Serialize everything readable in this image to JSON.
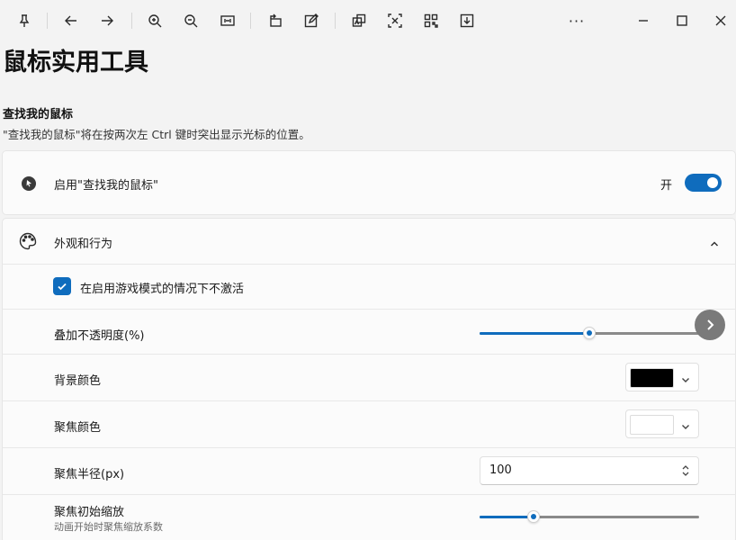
{
  "toolbar": {
    "buttons": [
      {
        "name": "pin-icon"
      },
      {
        "name": "back-arrow-icon"
      },
      {
        "name": "forward-arrow-icon"
      },
      {
        "name": "zoom-in-icon"
      },
      {
        "name": "zoom-out-icon"
      },
      {
        "name": "fit-width-icon"
      },
      {
        "name": "rotate-icon"
      },
      {
        "name": "edit-icon"
      },
      {
        "name": "translate-icon"
      },
      {
        "name": "crop-icon"
      },
      {
        "name": "qr-code-icon"
      },
      {
        "name": "download-icon"
      }
    ],
    "more_label": "···",
    "window_controls": [
      "minimize-icon",
      "maximize-icon",
      "close-icon"
    ]
  },
  "page": {
    "title": "鼠标实用工具",
    "section_title": "查找我的鼠标",
    "section_desc": "\"查找我的鼠标\"将在按两次左 Ctrl 键时突出显示光标的位置。"
  },
  "enable_card": {
    "label": "启用\"查找我的鼠标\"",
    "toggle_state_text": "开",
    "toggle_on": true
  },
  "appearance": {
    "header_label": "外观和行为",
    "expanded": true,
    "game_mode_checkbox": {
      "label": "在启用游戏模式的情况下不激活",
      "checked": true
    },
    "overlay_opacity": {
      "label": "叠加不透明度(%)",
      "value_fraction": 0.5
    },
    "background_color": {
      "label": "背景颜色",
      "color": "#000000"
    },
    "spotlight_color": {
      "label": "聚焦颜色",
      "color": "#ffffff"
    },
    "spotlight_radius": {
      "label": "聚焦半径(px)",
      "value": "100"
    },
    "spotlight_zoom": {
      "label": "聚焦初始缩放",
      "sub_label": "动画开始时聚焦缩放系数",
      "value_fraction": 0.23
    }
  },
  "colors": {
    "accent": "#0f6cbd",
    "track": "#8a8a8a"
  }
}
